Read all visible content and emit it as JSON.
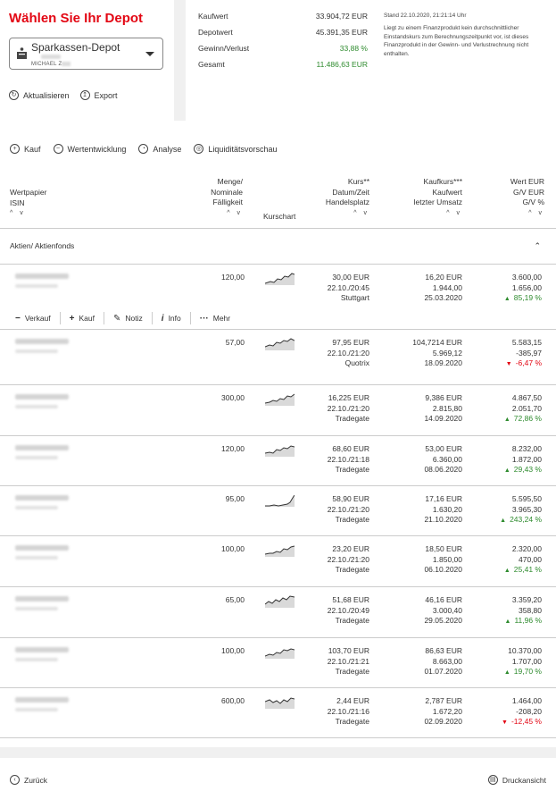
{
  "header": {
    "title": "Wählen Sie Ihr Depot",
    "depot_select": {
      "label": "Sparkassen-Depot",
      "owner": "MICHAEL Z"
    },
    "actions": [
      {
        "label": "Aktualisieren"
      },
      {
        "label": "Export"
      }
    ]
  },
  "summary": {
    "rows": [
      {
        "label": "Kaufwert",
        "value": "33.904,72 EUR",
        "color": ""
      },
      {
        "label": "Depotwert",
        "value": "45.391,35 EUR",
        "color": ""
      },
      {
        "label": "Gewinn/Verlust",
        "value": "33,88 %",
        "color": "#2e8b2e"
      },
      {
        "label": "Gesamt",
        "value": "11.486,63 EUR",
        "color": "#2e8b2e"
      }
    ],
    "stand": "Stand 22.10.2020, 21:21:14 Uhr",
    "note": "Liegt zu einem Finanzprodukt kein durchschnittlicher Einstandskurs zum Berechnungszeitpunkt vor, ist dieses Finanzprodukt in der Gewinn- und Verlustrechnung nicht enthalten."
  },
  "toolbar": [
    {
      "label": "Kauf",
      "icon": "plus-icon"
    },
    {
      "label": "Wertentwicklung",
      "icon": "trend-icon"
    },
    {
      "label": "Analyse",
      "icon": "analyse-icon"
    },
    {
      "label": "Liquiditätsvorschau",
      "icon": "liquidity-icon"
    }
  ],
  "columns": {
    "c1": [
      "Wertpapier",
      "ISIN"
    ],
    "c2": [
      "Menge/",
      "Nominale",
      "Fälligkeit"
    ],
    "c3": [
      "Kurschart"
    ],
    "c4": [
      "Kurs**",
      "Datum/Zeit",
      "Handelsplatz"
    ],
    "c5": [
      "Kaufkurs***",
      "Kaufwert",
      "letzter Umsatz"
    ],
    "c6": [
      "Wert EUR",
      "G/V EUR",
      "G/V %"
    ],
    "sort": "^ v"
  },
  "section": {
    "label": "Aktien/ Aktienfonds"
  },
  "row_actions": [
    {
      "label": "Verkauf",
      "icon": "minus-icon"
    },
    {
      "label": "Kauf",
      "icon": "plus-icon"
    },
    {
      "label": "Notiz",
      "icon": "note-icon"
    },
    {
      "label": "Info",
      "icon": "info-icon"
    },
    {
      "label": "Mehr",
      "icon": "more-icon"
    }
  ],
  "rows": [
    {
      "qty": "120,00",
      "kurs": "30,00 EUR",
      "zeit": "22.10./20:45",
      "platz": "Stuttgart",
      "kaufkurs": "16,20 EUR",
      "kaufwert": "1.944,00",
      "umsatz": "25.03.2020",
      "wert": "3.600,00",
      "gv": "1.656,00",
      "gvp": "85,19 %",
      "up": true
    },
    {
      "qty": "57,00",
      "kurs": "97,95 EUR",
      "zeit": "22.10./21:20",
      "platz": "Quotrix",
      "kaufkurs": "104,7214 EUR",
      "kaufwert": "5.969,12",
      "umsatz": "18.09.2020",
      "wert": "5.583,15",
      "gv": "-385,97",
      "gvp": "-6,47 %",
      "up": false
    },
    {
      "qty": "300,00",
      "kurs": "16,225 EUR",
      "zeit": "22.10./21:20",
      "platz": "Tradegate",
      "kaufkurs": "9,386 EUR",
      "kaufwert": "2.815,80",
      "umsatz": "14.09.2020",
      "wert": "4.867,50",
      "gv": "2.051,70",
      "gvp": "72,86 %",
      "up": true
    },
    {
      "qty": "120,00",
      "kurs": "68,60 EUR",
      "zeit": "22.10./21:18",
      "platz": "Tradegate",
      "kaufkurs": "53,00 EUR",
      "kaufwert": "6.360,00",
      "umsatz": "08.06.2020",
      "wert": "8.232,00",
      "gv": "1.872,00",
      "gvp": "29,43 %",
      "up": true
    },
    {
      "qty": "95,00",
      "kurs": "58,90 EUR",
      "zeit": "22.10./21:20",
      "platz": "Tradegate",
      "kaufkurs": "17,16 EUR",
      "kaufwert": "1.630,20",
      "umsatz": "21.10.2020",
      "wert": "5.595,50",
      "gv": "3.965,30",
      "gvp": "243,24 %",
      "up": true
    },
    {
      "qty": "100,00",
      "kurs": "23,20 EUR",
      "zeit": "22.10./21:20",
      "platz": "Tradegate",
      "kaufkurs": "18,50 EUR",
      "kaufwert": "1.850,00",
      "umsatz": "06.10.2020",
      "wert": "2.320,00",
      "gv": "470,00",
      "gvp": "25,41 %",
      "up": true
    },
    {
      "qty": "65,00",
      "kurs": "51,68 EUR",
      "zeit": "22.10./20:49",
      "platz": "Tradegate",
      "kaufkurs": "46,16 EUR",
      "kaufwert": "3.000,40",
      "umsatz": "29.05.2020",
      "wert": "3.359,20",
      "gv": "358,80",
      "gvp": "11,96 %",
      "up": true
    },
    {
      "qty": "100,00",
      "kurs": "103,70 EUR",
      "zeit": "22.10./21:21",
      "platz": "Tradegate",
      "kaufkurs": "86,63 EUR",
      "kaufwert": "8.663,00",
      "umsatz": "01.07.2020",
      "wert": "10.370,00",
      "gv": "1.707,00",
      "gvp": "19,70 %",
      "up": true
    },
    {
      "qty": "600,00",
      "kurs": "2,44 EUR",
      "zeit": "22.10./21:16",
      "platz": "Tradegate",
      "kaufkurs": "2,787 EUR",
      "kaufwert": "1.672,20",
      "umsatz": "02.09.2020",
      "wert": "1.464,00",
      "gv": "-208,20",
      "gvp": "-12,45 %",
      "up": false
    }
  ],
  "footer": {
    "back": "Zurück",
    "print": "Druckansicht"
  },
  "colors": {
    "brand": "#e30613",
    "up": "#2e8b2e",
    "down": "#e30613"
  }
}
